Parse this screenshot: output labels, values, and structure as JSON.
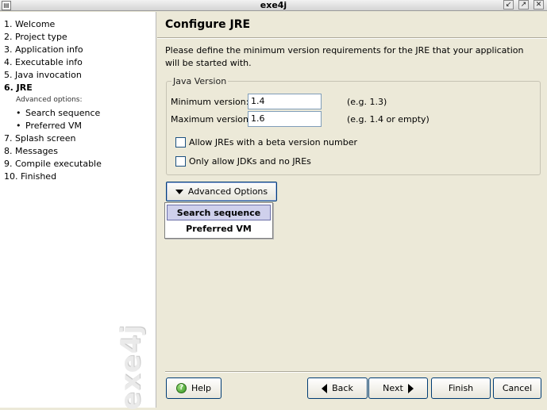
{
  "window": {
    "title": "exe4j",
    "icon": "app-icon",
    "controls": [
      "minimize-icon",
      "maximize-icon",
      "close-icon"
    ]
  },
  "sidebar": {
    "steps": [
      {
        "label": "1. Welcome"
      },
      {
        "label": "2. Project type"
      },
      {
        "label": "3. Application info"
      },
      {
        "label": "4. Executable info"
      },
      {
        "label": "5. Java invocation"
      },
      {
        "label": "6. JRE",
        "current": true
      },
      {
        "label": "7. Splash screen"
      },
      {
        "label": "8. Messages"
      },
      {
        "label": "9. Compile executable"
      },
      {
        "label": "10. Finished"
      }
    ],
    "advanced_header": "Advanced options:",
    "advanced_items": [
      {
        "label": "Search sequence"
      },
      {
        "label": "Preferred VM"
      }
    ],
    "logo_text": "exe4j"
  },
  "main": {
    "title": "Configure JRE",
    "description": "Please define the minimum version requirements for the JRE that your application will be started with.",
    "java_version": {
      "legend": "Java Version",
      "min_label": "Minimum version:",
      "min_value": "1.4",
      "min_hint": "(e.g. 1.3)",
      "max_label": "Maximum version:",
      "max_value": "1.6",
      "max_hint": "(e.g. 1.4 or empty)",
      "beta_label": "Allow JREs with a beta version number",
      "beta_checked": false,
      "jdk_label": "Only allow JDKs and no JREs",
      "jdk_checked": false
    },
    "advanced_button": "Advanced Options",
    "advanced_menu": [
      {
        "label": "Search sequence",
        "highlighted": true
      },
      {
        "label": "Preferred VM",
        "highlighted": false
      }
    ]
  },
  "buttons": {
    "help": "Help",
    "back": "Back",
    "next": "Next",
    "finish": "Finish",
    "cancel": "Cancel"
  }
}
